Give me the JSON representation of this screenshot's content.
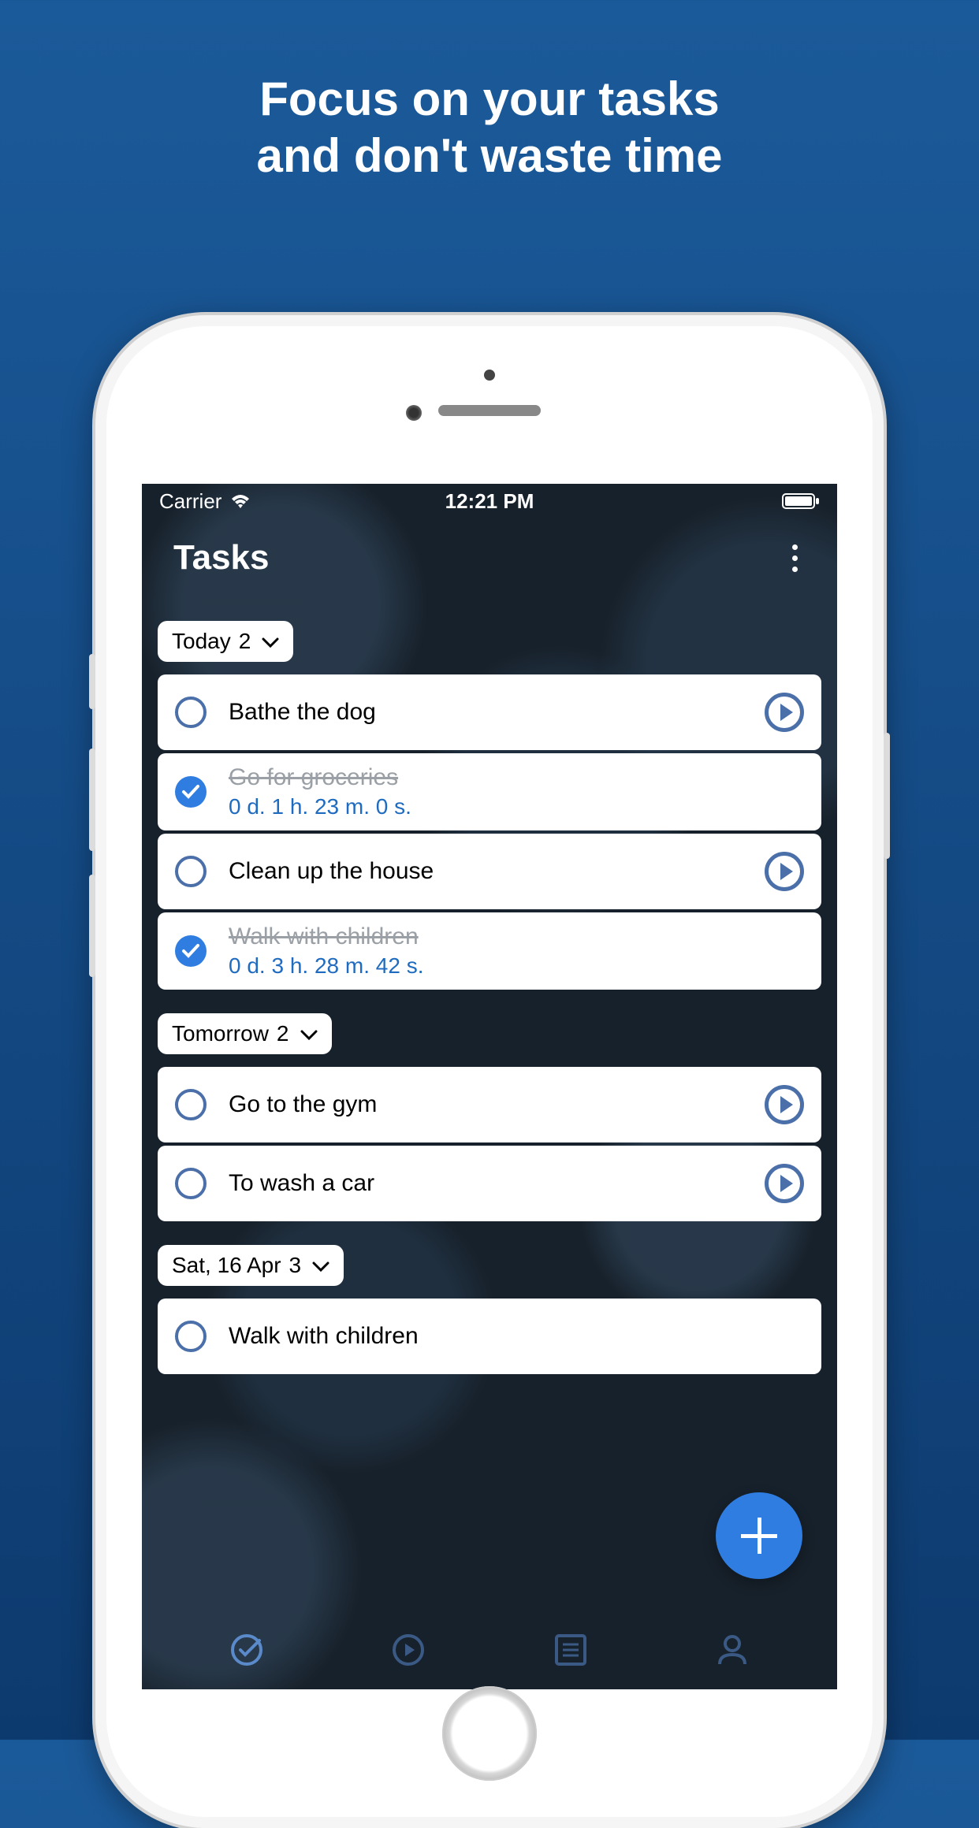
{
  "promo": {
    "line1": "Focus on your tasks",
    "line2": "and don't waste time"
  },
  "statusBar": {
    "carrier": "Carrier",
    "time": "12:21 PM"
  },
  "nav": {
    "title": "Tasks"
  },
  "sections": [
    {
      "label": "Today",
      "count": "2",
      "tasks": [
        {
          "title": "Bathe the dog",
          "completed": false,
          "duration": null,
          "showPlay": true
        },
        {
          "title": "Go for groceries",
          "completed": true,
          "duration": "0 d. 1 h. 23 m. 0 s.",
          "showPlay": false
        },
        {
          "title": "Clean up the house",
          "completed": false,
          "duration": null,
          "showPlay": true
        },
        {
          "title": "Walk with children",
          "completed": true,
          "duration": "0 d. 3 h. 28 m. 42 s.",
          "showPlay": false
        }
      ]
    },
    {
      "label": "Tomorrow",
      "count": "2",
      "tasks": [
        {
          "title": "Go to the gym",
          "completed": false,
          "duration": null,
          "showPlay": true
        },
        {
          "title": "To wash a car",
          "completed": false,
          "duration": null,
          "showPlay": true
        }
      ]
    },
    {
      "label": "Sat, 16 Apr",
      "count": "3",
      "tasks": [
        {
          "title": "Walk with children",
          "completed": false,
          "duration": null,
          "showPlay": false
        }
      ]
    }
  ],
  "colors": {
    "accent": "#2f7de1",
    "iconBlue": "#4b6fa8"
  }
}
